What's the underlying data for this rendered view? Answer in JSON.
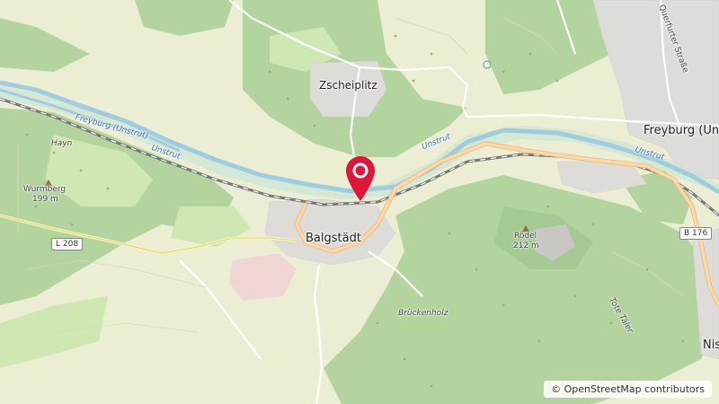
{
  "map": {
    "places": {
      "zscheiplitz": "Zscheiplitz",
      "freyburg": "Freyburg (Un",
      "balgstaedt": "Balgstädt",
      "hayn": "Hayn",
      "nis": "Nis"
    },
    "peaks": {
      "wurmberg_name": "Wurmberg",
      "wurmberg_elev": "199 m",
      "roedel_name": "Rödel",
      "roedel_elev": "212 m"
    },
    "rivers": {
      "freyburg_unstrut": "Freyburg (Unstrut)",
      "unstrut_west": "Unstrut",
      "unstrut_center": "Unstrut",
      "unstrut_east": "Unstrut"
    },
    "streets": {
      "querfurter": "Querfurter Straße"
    },
    "areas": {
      "brueckenholz": "Brückenholz",
      "tote_taeler": "Tote Täler"
    },
    "roads": {
      "l208": "L 208",
      "b176": "B 176"
    },
    "marker_icon": "map-pin-icon",
    "marker_color": "#e0153a",
    "colors": {
      "forest": "#add19e",
      "farmland": "#eef0d5",
      "meadow": "#cdebb0",
      "water": "#aad3df",
      "river_line": "#9ec6e0",
      "railway": "#777777",
      "main_road": "#fcd6a4",
      "residential": "#e0dfdf"
    }
  },
  "attribution": {
    "symbol": "©",
    "text": "OpenStreetMap contributors"
  }
}
